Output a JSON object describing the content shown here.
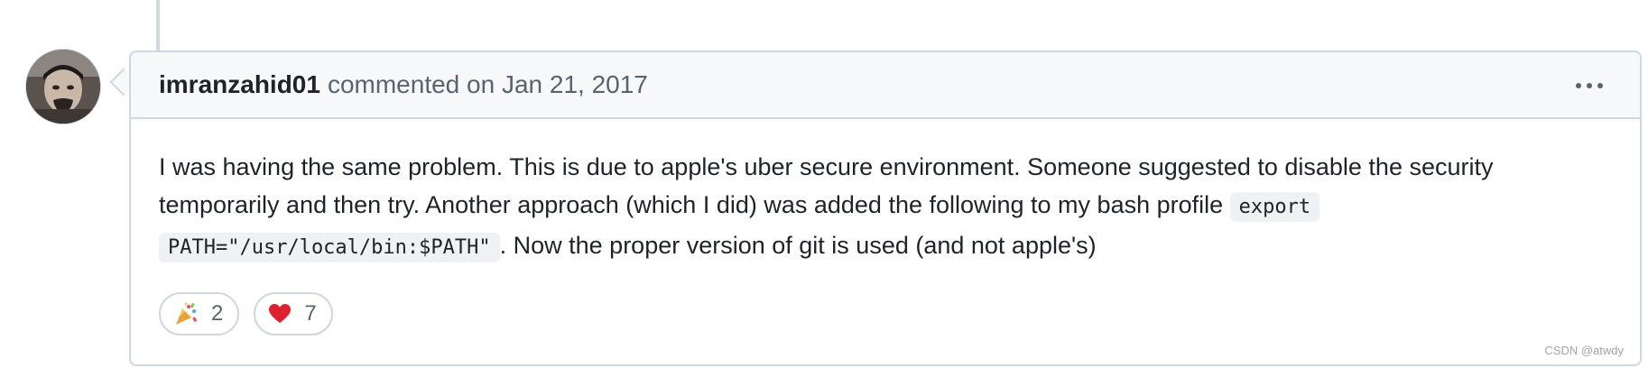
{
  "comment": {
    "author": "imranzahid01",
    "meta": "commented on Jan 21, 2017",
    "menu_icon": "kebab-horizontal-icon",
    "body_text_1": "I was having the same problem. This is due to apple's uber secure environment. Someone suggested to disable the security temporarily and then try. Another approach (which I did) was added the following to my bash profile ",
    "body_code": "export PATH=\"/usr/local/bin:$PATH\"",
    "body_text_2": ". Now the proper version of git is used (and not apple's)"
  },
  "reactions": [
    {
      "icon": "tada-emoji",
      "count": "2"
    },
    {
      "icon": "red-heart-emoji",
      "count": "7"
    }
  ],
  "watermark": "CSDN @atwdy",
  "colors": {
    "border": "#d0d7de",
    "header_bg": "#f6f8fa",
    "muted_text": "#59636e",
    "heart": "#e0202e"
  }
}
